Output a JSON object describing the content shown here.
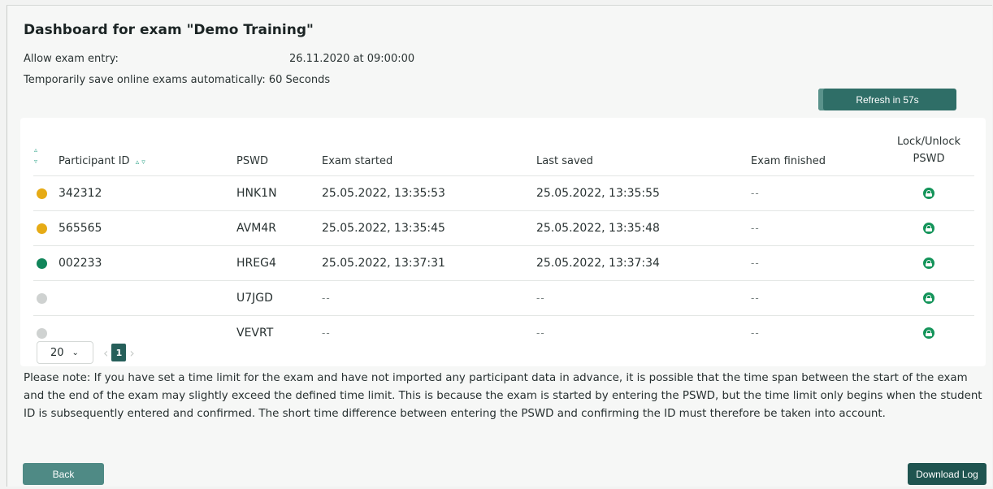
{
  "page": {
    "title": "Dashboard for exam \"Demo Training\"",
    "entry_label": "Allow exam entry:",
    "entry_value": "26.11.2020 at 09:00:00",
    "autosave_label": "Temporarily save online exams automatically:",
    "autosave_value": "60 Seconds",
    "refresh_label": "Refresh in 57s"
  },
  "table": {
    "headers": {
      "participant_id": "Participant ID",
      "pswd": "PSWD",
      "exam_started": "Exam started",
      "last_saved": "Last saved",
      "exam_finished": "Exam finished",
      "lock_line1": "Lock/Unlock",
      "lock_line2": "PSWD"
    },
    "status_colors": {
      "in_progress": "#e6ab16",
      "finished_saved": "#11855a",
      "not_started": "#cfd2d1",
      "lock": "#14945a"
    },
    "rows": [
      {
        "status": "in_progress",
        "participant_id": "342312",
        "pswd": "HNK1N",
        "exam_started": "25.05.2022, 13:35:53",
        "last_saved": "25.05.2022, 13:35:55",
        "exam_finished": "--",
        "lock_icon": "lock-open-icon"
      },
      {
        "status": "in_progress",
        "participant_id": "565565",
        "pswd": "AVM4R",
        "exam_started": "25.05.2022, 13:35:45",
        "last_saved": "25.05.2022, 13:35:48",
        "exam_finished": "--",
        "lock_icon": "lock-open-icon"
      },
      {
        "status": "finished_saved",
        "participant_id": "002233",
        "pswd": "HREG4",
        "exam_started": "25.05.2022, 13:37:31",
        "last_saved": "25.05.2022, 13:37:34",
        "exam_finished": "--",
        "lock_icon": "lock-open-icon"
      },
      {
        "status": "not_started",
        "participant_id": "",
        "pswd": "U7JGD",
        "exam_started": "--",
        "last_saved": "--",
        "exam_finished": "--",
        "lock_icon": "lock-open-icon"
      },
      {
        "status": "not_started",
        "participant_id": "",
        "pswd": "VEVRT",
        "exam_started": "--",
        "last_saved": "--",
        "exam_finished": "--",
        "lock_icon": "lock-open-icon"
      }
    ]
  },
  "pagination": {
    "page_size": "20",
    "current_page": "1"
  },
  "note": "Please note: If you have set a time limit for the exam and have not imported any participant data in advance, it is possible that the time span between the start of the exam and the end of the exam may slightly exceed the defined time limit. This is because the exam is started by entering the PSWD, but the time limit only begins when the student ID is subsequently entered and confirmed. The short time difference between entering the PSWD and confirming the ID must therefore be taken into account.",
  "buttons": {
    "back": "Back",
    "download_log": "Download Log"
  }
}
